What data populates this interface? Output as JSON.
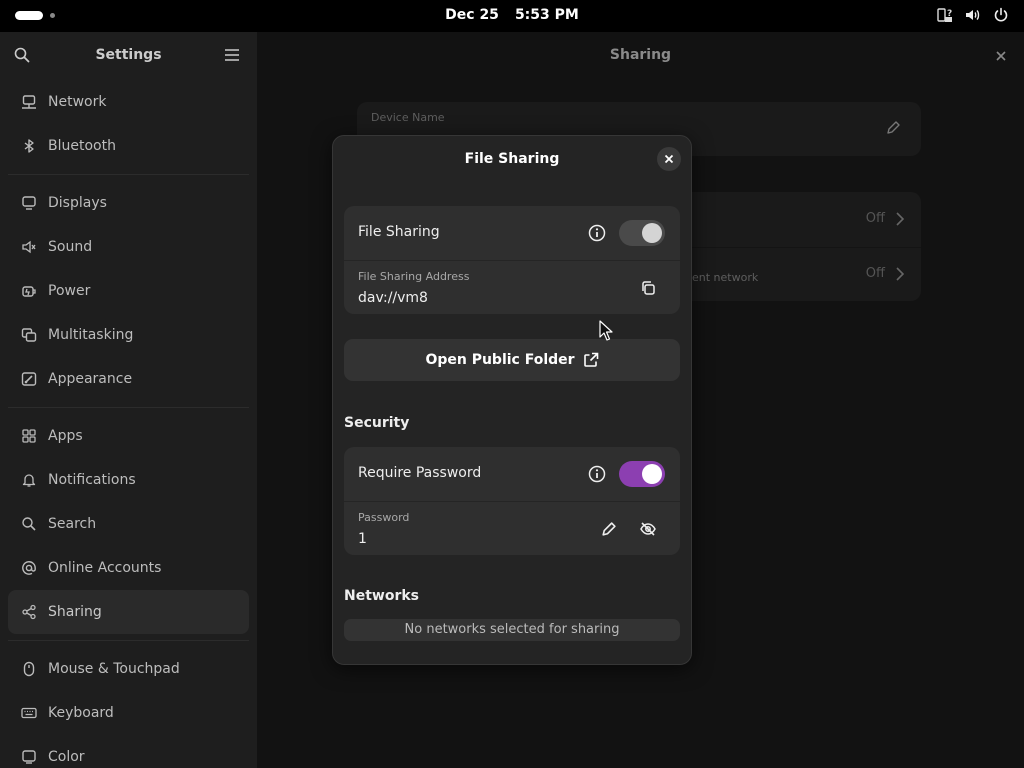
{
  "topbar": {
    "date": "Dec 25",
    "time": "5:53 PM",
    "tray_icons": [
      "accessibility-icon",
      "volume-icon",
      "power-icon"
    ]
  },
  "sidebar": {
    "title": "Settings",
    "items": [
      {
        "label": "Network",
        "icon": "network-icon"
      },
      {
        "label": "Bluetooth",
        "icon": "bluetooth-icon"
      },
      {
        "label": "Displays",
        "icon": "display-icon"
      },
      {
        "label": "Sound",
        "icon": "sound-icon"
      },
      {
        "label": "Power",
        "icon": "power-plug-icon"
      },
      {
        "label": "Multitasking",
        "icon": "multitasking-icon"
      },
      {
        "label": "Appearance",
        "icon": "appearance-icon"
      },
      {
        "label": "Apps",
        "icon": "apps-grid-icon"
      },
      {
        "label": "Notifications",
        "icon": "bell-icon"
      },
      {
        "label": "Search",
        "icon": "search-icon"
      },
      {
        "label": "Online Accounts",
        "icon": "at-sign-icon"
      },
      {
        "label": "Sharing",
        "icon": "share-icon"
      },
      {
        "label": "Mouse & Touchpad",
        "icon": "mouse-icon"
      },
      {
        "label": "Keyboard",
        "icon": "keyboard-icon"
      },
      {
        "label": "Color",
        "icon": "color-icon"
      }
    ],
    "active": "Sharing"
  },
  "main": {
    "title": "Sharing",
    "device_name_label": "Device Name",
    "row1_status": "Off",
    "row2_status": "Off",
    "row2_sub_fragment": "ent network"
  },
  "dialog": {
    "title": "File Sharing",
    "file_sharing": {
      "label": "File Sharing",
      "enabled": false
    },
    "address": {
      "label": "File Sharing Address",
      "value": "dav://vm8"
    },
    "open_folder_button": "Open Public Folder",
    "security_heading": "Security",
    "require_password": {
      "label": "Require Password",
      "enabled": true
    },
    "password": {
      "label": "Password",
      "value": "1"
    },
    "networks_heading": "Networks",
    "networks_empty": "No networks selected for sharing"
  },
  "colors": {
    "accent": "#8c3fb1",
    "sidebar_bg": "#1e1e1e",
    "dialog_bg": "#242424",
    "row_bg": "#2f2f2f"
  }
}
